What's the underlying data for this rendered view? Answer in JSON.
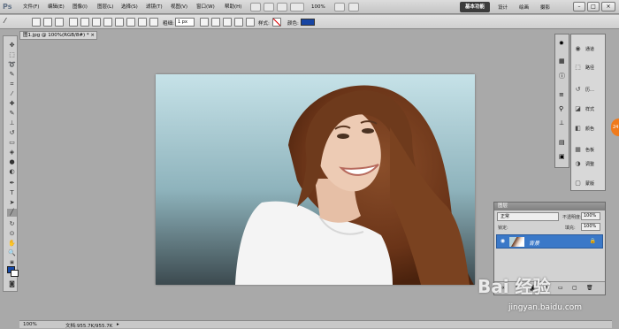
{
  "app": {
    "logo": "Ps"
  },
  "menu": {
    "items": [
      "文件(F)",
      "编辑(E)",
      "图像(I)",
      "图层(L)",
      "选择(S)",
      "滤镜(T)",
      "视图(V)",
      "窗口(W)",
      "帮助(H)"
    ],
    "zoom": "100%"
  },
  "workspace": {
    "active": "基本功能",
    "items": [
      "设计",
      "绘画",
      "摄影"
    ]
  },
  "options": {
    "weight_label": "粗细:",
    "weight_value": "1 px",
    "style_label": "样式:",
    "color_label": "颜色:",
    "color": "#1745a3"
  },
  "document": {
    "tab_title": "图1.jpg @ 100%(RGB/8#) *"
  },
  "status": {
    "zoom": "100%",
    "doc_info": "文档:955.7K/955.7K"
  },
  "panels": {
    "items": [
      "通道",
      "路径",
      "历…",
      "样式",
      "颜色",
      "色板",
      "调整",
      "蒙版"
    ]
  },
  "layers": {
    "title": "图层",
    "blend_mode": "正常",
    "opacity_label": "不透明度:",
    "opacity": "100%",
    "lock_label": "锁定:",
    "fill_label": "填充:",
    "fill": "100%",
    "layer_name": "背景"
  },
  "badge": {
    "label": "24"
  },
  "watermark": {
    "brand": "Bai 经验",
    "url": "jingyan.baidu.com"
  },
  "colors": {
    "accent": "#3a78c8",
    "foreground": "#1649a8",
    "background": "#ffffff"
  }
}
